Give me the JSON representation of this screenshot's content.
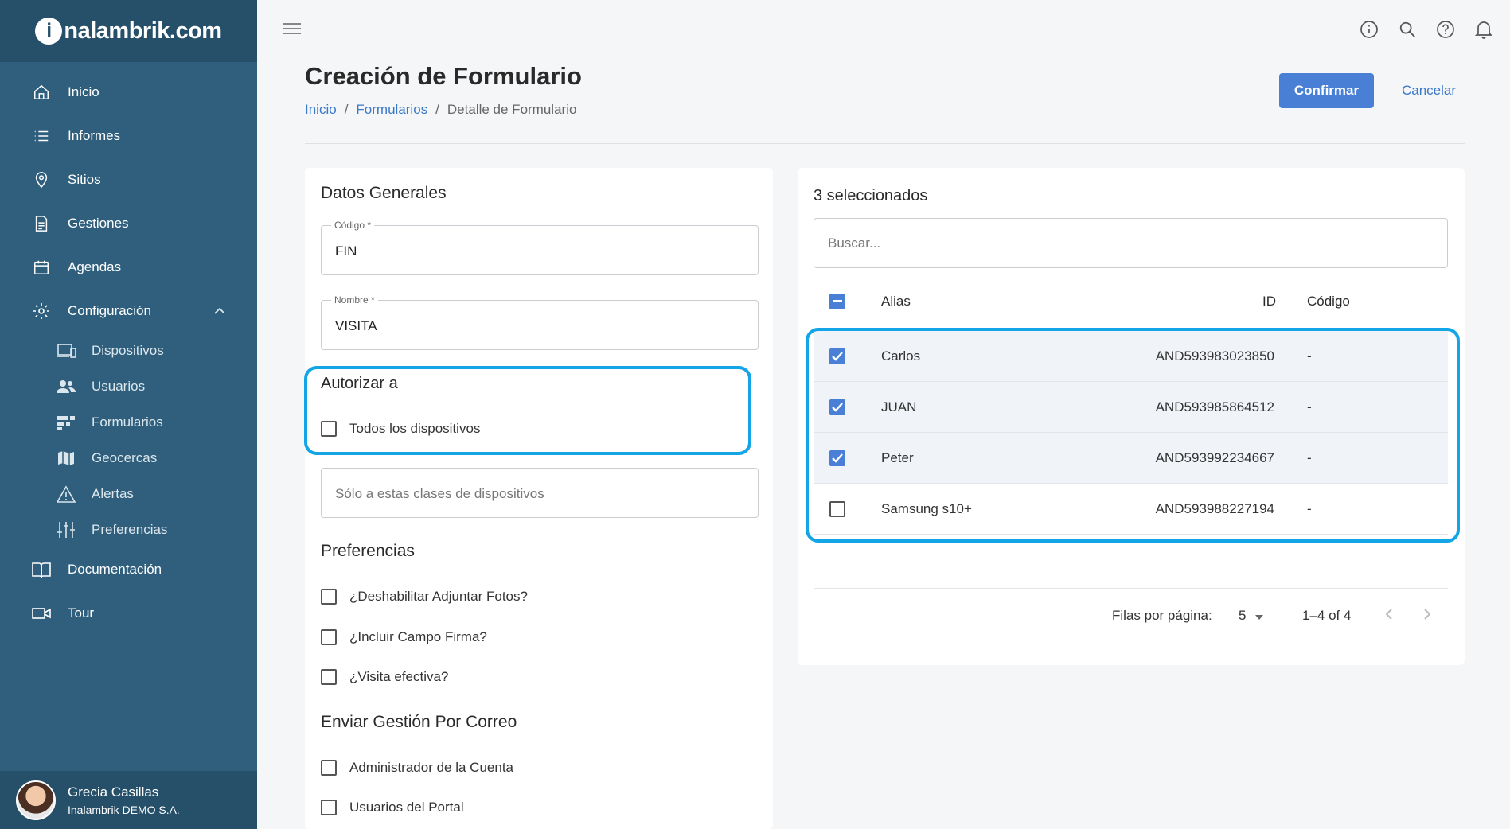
{
  "brand": {
    "logo_letter": "i",
    "name": "nalambrik.com"
  },
  "nav": [
    {
      "label": "Inicio",
      "icon": "home-icon"
    },
    {
      "label": "Informes",
      "icon": "list-icon"
    },
    {
      "label": "Sitios",
      "icon": "location-pin-icon"
    },
    {
      "label": "Gestiones",
      "icon": "document-icon"
    },
    {
      "label": "Agendas",
      "icon": "calendar-icon"
    },
    {
      "label": "Configuración",
      "icon": "gear-icon"
    }
  ],
  "subnav": [
    {
      "label": "Dispositivos",
      "icon": "devices-icon"
    },
    {
      "label": "Usuarios",
      "icon": "users-icon"
    },
    {
      "label": "Formularios",
      "icon": "forms-icon"
    },
    {
      "label": "Geocercas",
      "icon": "map-icon"
    },
    {
      "label": "Alertas",
      "icon": "warning-icon"
    },
    {
      "label": "Preferencias",
      "icon": "sliders-icon"
    }
  ],
  "nav_bottom": [
    {
      "label": "Documentación",
      "icon": "book-icon"
    },
    {
      "label": "Tour",
      "icon": "video-icon"
    }
  ],
  "user": {
    "name": "Grecia Casillas",
    "org": "Inalambrik DEMO S.A."
  },
  "page": {
    "title": "Creación de Formulario",
    "breadcrumb": [
      "Inicio",
      "Formularios",
      "Detalle de Formulario"
    ],
    "sep": "/",
    "confirm": "Confirmar",
    "cancel": "Cancelar"
  },
  "general": {
    "title": "Datos Generales",
    "code_label": "Código *",
    "code_value": "FIN",
    "name_label": "Nombre *",
    "name_value": "VISITA"
  },
  "authorize": {
    "title": "Autorizar a",
    "all_devices": "Todos los dispositivos",
    "classes_placeholder": "Sólo a estas clases de dispositivos"
  },
  "preferences": {
    "title": "Preferencias",
    "items": [
      "¿Deshabilitar Adjuntar Fotos?",
      "¿Incluir Campo Firma?",
      "¿Visita efectiva?"
    ]
  },
  "email": {
    "title": "Enviar Gestión Por Correo",
    "items": [
      "Administrador de la Cuenta",
      "Usuarios del Portal"
    ]
  },
  "devices": {
    "selected_count": "3 seleccionados",
    "search_placeholder": "Buscar...",
    "columns": {
      "alias": "Alias",
      "id": "ID",
      "code": "Código"
    },
    "rows": [
      {
        "alias": "Carlos",
        "id": "AND593983023850",
        "code": "-",
        "checked": true
      },
      {
        "alias": "JUAN",
        "id": "AND593985864512",
        "code": "-",
        "checked": true
      },
      {
        "alias": "Peter",
        "id": "AND593992234667",
        "code": "-",
        "checked": true
      },
      {
        "alias": "Samsung s10+",
        "id": "AND593988227194",
        "code": "-",
        "checked": false
      }
    ],
    "rows_per_page_label": "Filas por página:",
    "rows_per_page": "5",
    "range": "1–4 of 4"
  },
  "colors": {
    "sidebar": "#2f5f7c",
    "accent": "#4a7fd6",
    "highlight": "#13a5e6"
  }
}
